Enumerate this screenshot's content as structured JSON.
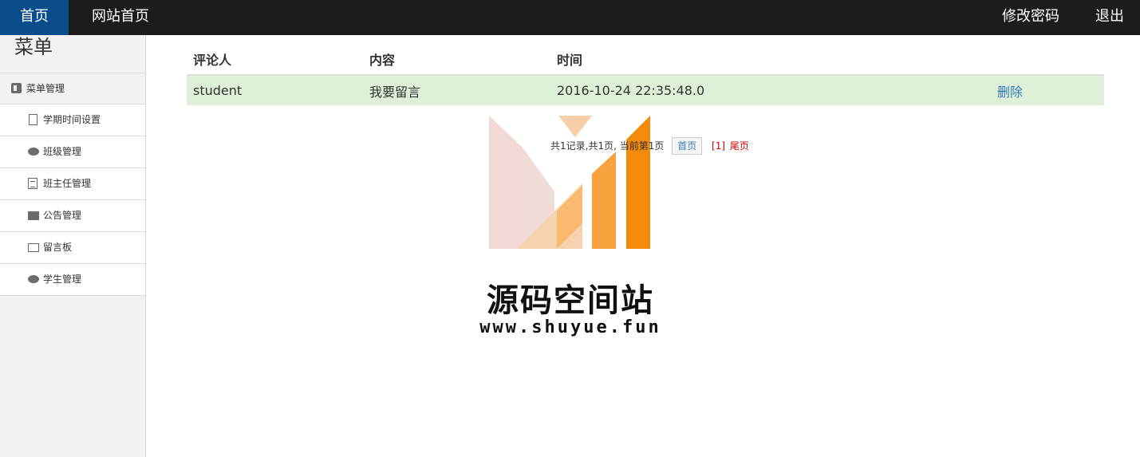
{
  "navbar": {
    "home": "首页",
    "site_home": "网站首页",
    "change_password": "修改密码",
    "logout": "退出",
    "active_color": "#0a4d8c"
  },
  "sidebar": {
    "title": "菜单",
    "group": {
      "label": "菜单管理",
      "icon": "dashboard-icon"
    },
    "items": [
      {
        "label": "学期时间设置",
        "icon": "file-icon"
      },
      {
        "label": "班级管理",
        "icon": "comment-icon"
      },
      {
        "label": "班主任管理",
        "icon": "list-icon"
      },
      {
        "label": "公告管理",
        "icon": "book-icon"
      },
      {
        "label": "留言板",
        "icon": "envelope-icon"
      },
      {
        "label": "学生管理",
        "icon": "comment-icon"
      }
    ]
  },
  "table": {
    "headers": [
      "评论人",
      "内容",
      "时间",
      ""
    ],
    "rows": [
      {
        "author": "student",
        "content": "我要留言",
        "time": "2016-10-24 22:35:48.0",
        "action": "删除"
      }
    ],
    "row_highlight_color": "#dff0d8"
  },
  "pager": {
    "summary": "共1记录,共1页, 当前第1页",
    "first": "首页",
    "page_link": "[1]",
    "last": "尾页"
  },
  "watermark": {
    "title": "源码空间站",
    "url": "www.shuyue.fun"
  }
}
